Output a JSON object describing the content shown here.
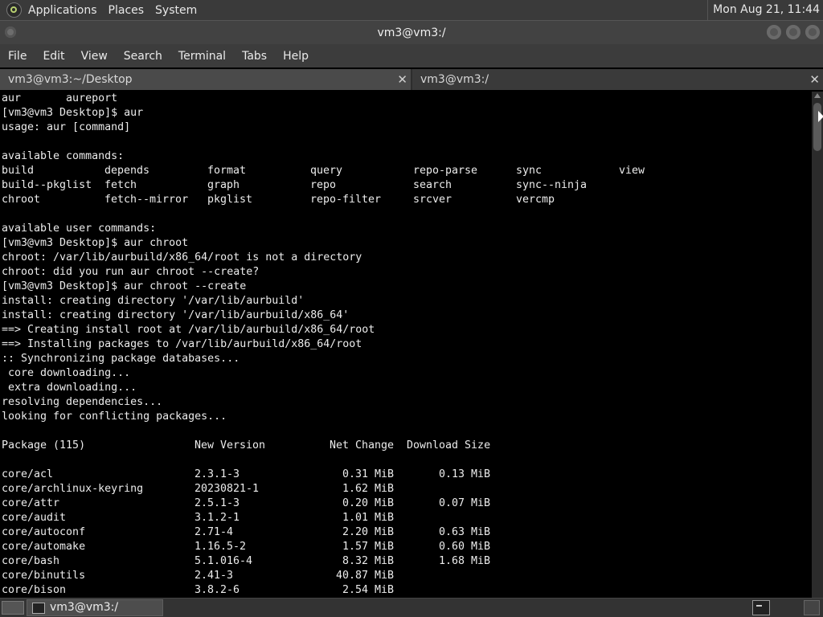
{
  "top_panel": {
    "menus": [
      "Applications",
      "Places",
      "System"
    ],
    "clock": "Mon Aug 21, 11:44"
  },
  "window": {
    "title": "vm3@vm3:/"
  },
  "menubar": [
    "File",
    "Edit",
    "View",
    "Search",
    "Terminal",
    "Tabs",
    "Help"
  ],
  "tabs": [
    {
      "label": "vm3@vm3:~/Desktop",
      "active": false
    },
    {
      "label": "vm3@vm3:/",
      "active": true
    }
  ],
  "terminal": {
    "pre_lines": [
      "aur       aureport",
      "[vm3@vm3 Desktop]$ aur",
      "usage: aur [command]",
      "",
      "available commands:"
    ],
    "commands_grid": [
      [
        "build",
        "depends",
        "format",
        "query",
        "repo-parse",
        "sync",
        "view"
      ],
      [
        "build--pkglist",
        "fetch",
        "graph",
        "repo",
        "search",
        "sync--ninja",
        ""
      ],
      [
        "chroot",
        "fetch--mirror",
        "pkglist",
        "repo-filter",
        "srcver",
        "vercmp",
        ""
      ]
    ],
    "mid_lines": [
      "",
      "available user commands:",
      "[vm3@vm3 Desktop]$ aur chroot",
      "chroot: /var/lib/aurbuild/x86_64/root is not a directory",
      "chroot: did you run aur chroot --create?",
      "[vm3@vm3 Desktop]$ aur chroot --create",
      "install: creating directory '/var/lib/aurbuild'",
      "install: creating directory '/var/lib/aurbuild/x86_64'",
      "==> Creating install root at /var/lib/aurbuild/x86_64/root",
      "==> Installing packages to /var/lib/aurbuild/x86_64/root",
      ":: Synchronizing package databases...",
      " core downloading...",
      " extra downloading...",
      "resolving dependencies...",
      "looking for conflicting packages...",
      ""
    ],
    "package_header": {
      "package": "Package (115)",
      "new_version": "New Version",
      "net_change": "Net Change",
      "download_size": "Download Size"
    },
    "packages": [
      {
        "name": "core/acl",
        "version": "2.3.1-3",
        "net": "0.31 MiB",
        "download": "0.13 MiB"
      },
      {
        "name": "core/archlinux-keyring",
        "version": "20230821-1",
        "net": "1.62 MiB",
        "download": ""
      },
      {
        "name": "core/attr",
        "version": "2.5.1-3",
        "net": "0.20 MiB",
        "download": "0.07 MiB"
      },
      {
        "name": "core/audit",
        "version": "3.1.2-1",
        "net": "1.01 MiB",
        "download": ""
      },
      {
        "name": "core/autoconf",
        "version": "2.71-4",
        "net": "2.20 MiB",
        "download": "0.63 MiB"
      },
      {
        "name": "core/automake",
        "version": "1.16.5-2",
        "net": "1.57 MiB",
        "download": "0.60 MiB"
      },
      {
        "name": "core/bash",
        "version": "5.1.016-4",
        "net": "8.32 MiB",
        "download": "1.68 MiB"
      },
      {
        "name": "core/binutils",
        "version": "2.41-3",
        "net": "40.87 MiB",
        "download": ""
      },
      {
        "name": "core/bison",
        "version": "3.8.2-6",
        "net": "2.54 MiB",
        "download": ""
      }
    ]
  },
  "taskbar": {
    "task_label": "vm3@vm3:/"
  }
}
